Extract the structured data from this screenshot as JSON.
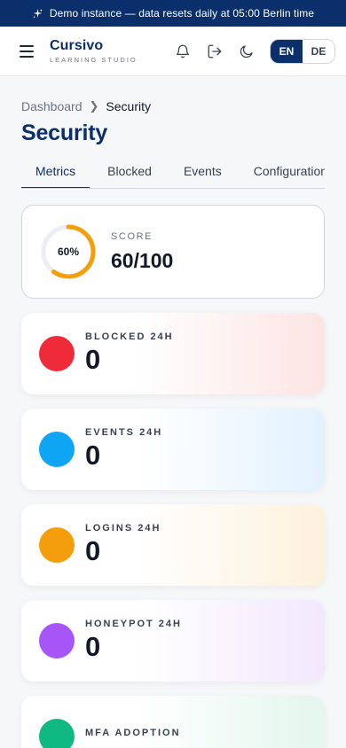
{
  "banner": {
    "text": "Demo instance — data resets daily at 05:00 Berlin time",
    "icon": "sparkle-icon"
  },
  "header": {
    "brand_name": "Cursivo",
    "brand_sub": "LEARNING STUDIO",
    "icons": [
      "menu-icon",
      "bell-icon",
      "logout-icon",
      "moon-icon"
    ],
    "languages": [
      {
        "code": "EN",
        "active": true
      },
      {
        "code": "DE",
        "active": false
      }
    ]
  },
  "breadcrumb": {
    "parent": "Dashboard",
    "current": "Security"
  },
  "page": {
    "title": "Security"
  },
  "tabs": [
    {
      "label": "Metrics",
      "active": true
    },
    {
      "label": "Blocked",
      "active": false
    },
    {
      "label": "Events",
      "active": false
    },
    {
      "label": "Configuration",
      "active": false
    }
  ],
  "score": {
    "label": "SCORE",
    "value": "60/100",
    "percent_text": "60%",
    "percent": 60,
    "color": "#f59e0b"
  },
  "metrics": [
    {
      "label": "BLOCKED 24H",
      "value": "0",
      "color": "#ef2b3a",
      "tint": "#fde4e4"
    },
    {
      "label": "EVENTS 24H",
      "value": "0",
      "color": "#0ea5f5",
      "tint": "#e2f2fd"
    },
    {
      "label": "LOGINS 24H",
      "value": "0",
      "color": "#f59e0b",
      "tint": "#fdf1dc"
    },
    {
      "label": "HONEYPOT 24H",
      "value": "0",
      "color": "#a855f7",
      "tint": "#f2e8fd"
    },
    {
      "label": "MFA ADOPTION",
      "value": "",
      "color": "#10b981",
      "tint": "#e3f6ee"
    }
  ]
}
